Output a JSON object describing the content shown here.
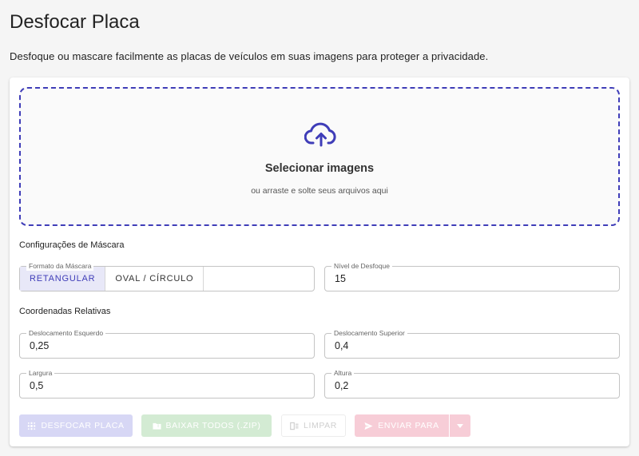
{
  "header": {
    "title": "Desfocar Placa",
    "description": "Desfoque ou mascare facilmente as placas de veículos em suas imagens para proteger a privacidade."
  },
  "dropzone": {
    "icon": "cloud-upload-icon",
    "title": "Selecionar imagens",
    "subtitle": "ou arraste e solte seus arquivos aqui"
  },
  "mask_settings": {
    "section_label": "Configurações de Máscara",
    "shape": {
      "label": "Formato da Máscara",
      "options": [
        "RETANGULAR",
        "OVAL / CÍRCULO"
      ],
      "selected": "RETANGULAR"
    },
    "blur_level": {
      "label": "Nível de Desfoque",
      "value": "15"
    }
  },
  "coordinates": {
    "section_label": "Coordenadas Relativas",
    "left_offset": {
      "label": "Deslocamento Esquerdo",
      "value": "0,25"
    },
    "top_offset": {
      "label": "Deslocamento Superior",
      "value": "0,4"
    },
    "width": {
      "label": "Largura",
      "value": "0,5"
    },
    "height": {
      "label": "Altura",
      "value": "0,2"
    }
  },
  "actions": {
    "blur_label": "DESFOCAR PLACA",
    "download_all_label": "BAIXAR TODOS (.ZIP)",
    "clear_label": "LIMPAR",
    "send_to_label": "ENVIAR PARA"
  },
  "colors": {
    "accent": "#3f3db8",
    "blur_button_disabled": "#d7d7f5",
    "zip_button_disabled": "#d3ebd3",
    "send_button_disabled": "#f7cdd7"
  }
}
